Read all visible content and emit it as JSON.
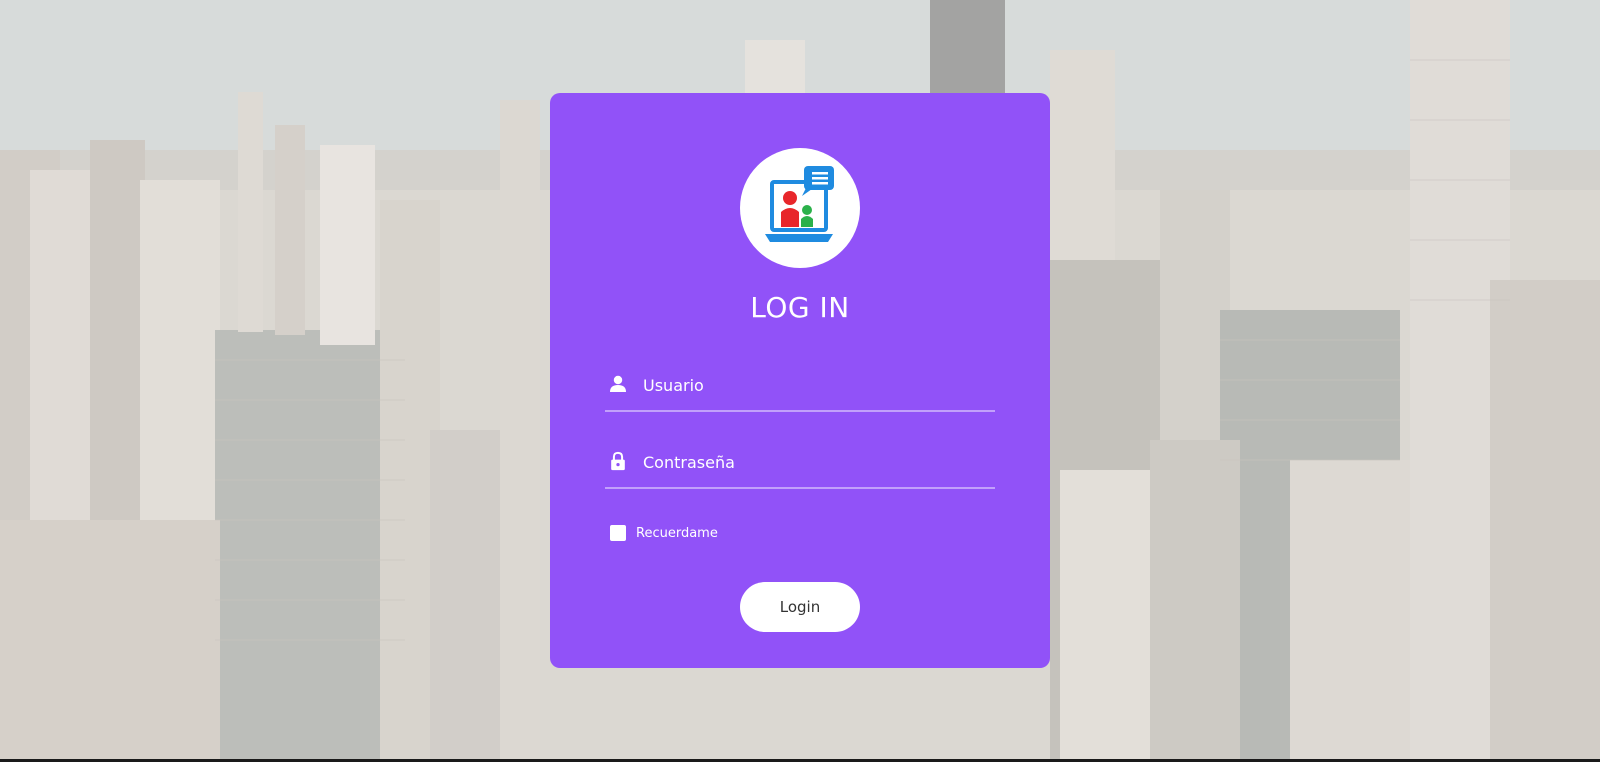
{
  "background": {
    "icon": "city-skyline-image",
    "tint_color": "#e6e2dc"
  },
  "login_card": {
    "background_color": "#9152f8",
    "logo_icon": "video-chat-logo-icon",
    "title": "LOG IN",
    "username": {
      "icon": "user-icon",
      "placeholder": "Usuario",
      "value": ""
    },
    "password": {
      "icon": "lock-icon",
      "placeholder": "Contraseña",
      "value": ""
    },
    "remember": {
      "label": "Recuerdame",
      "checked": false
    },
    "login_button_label": "Login"
  }
}
